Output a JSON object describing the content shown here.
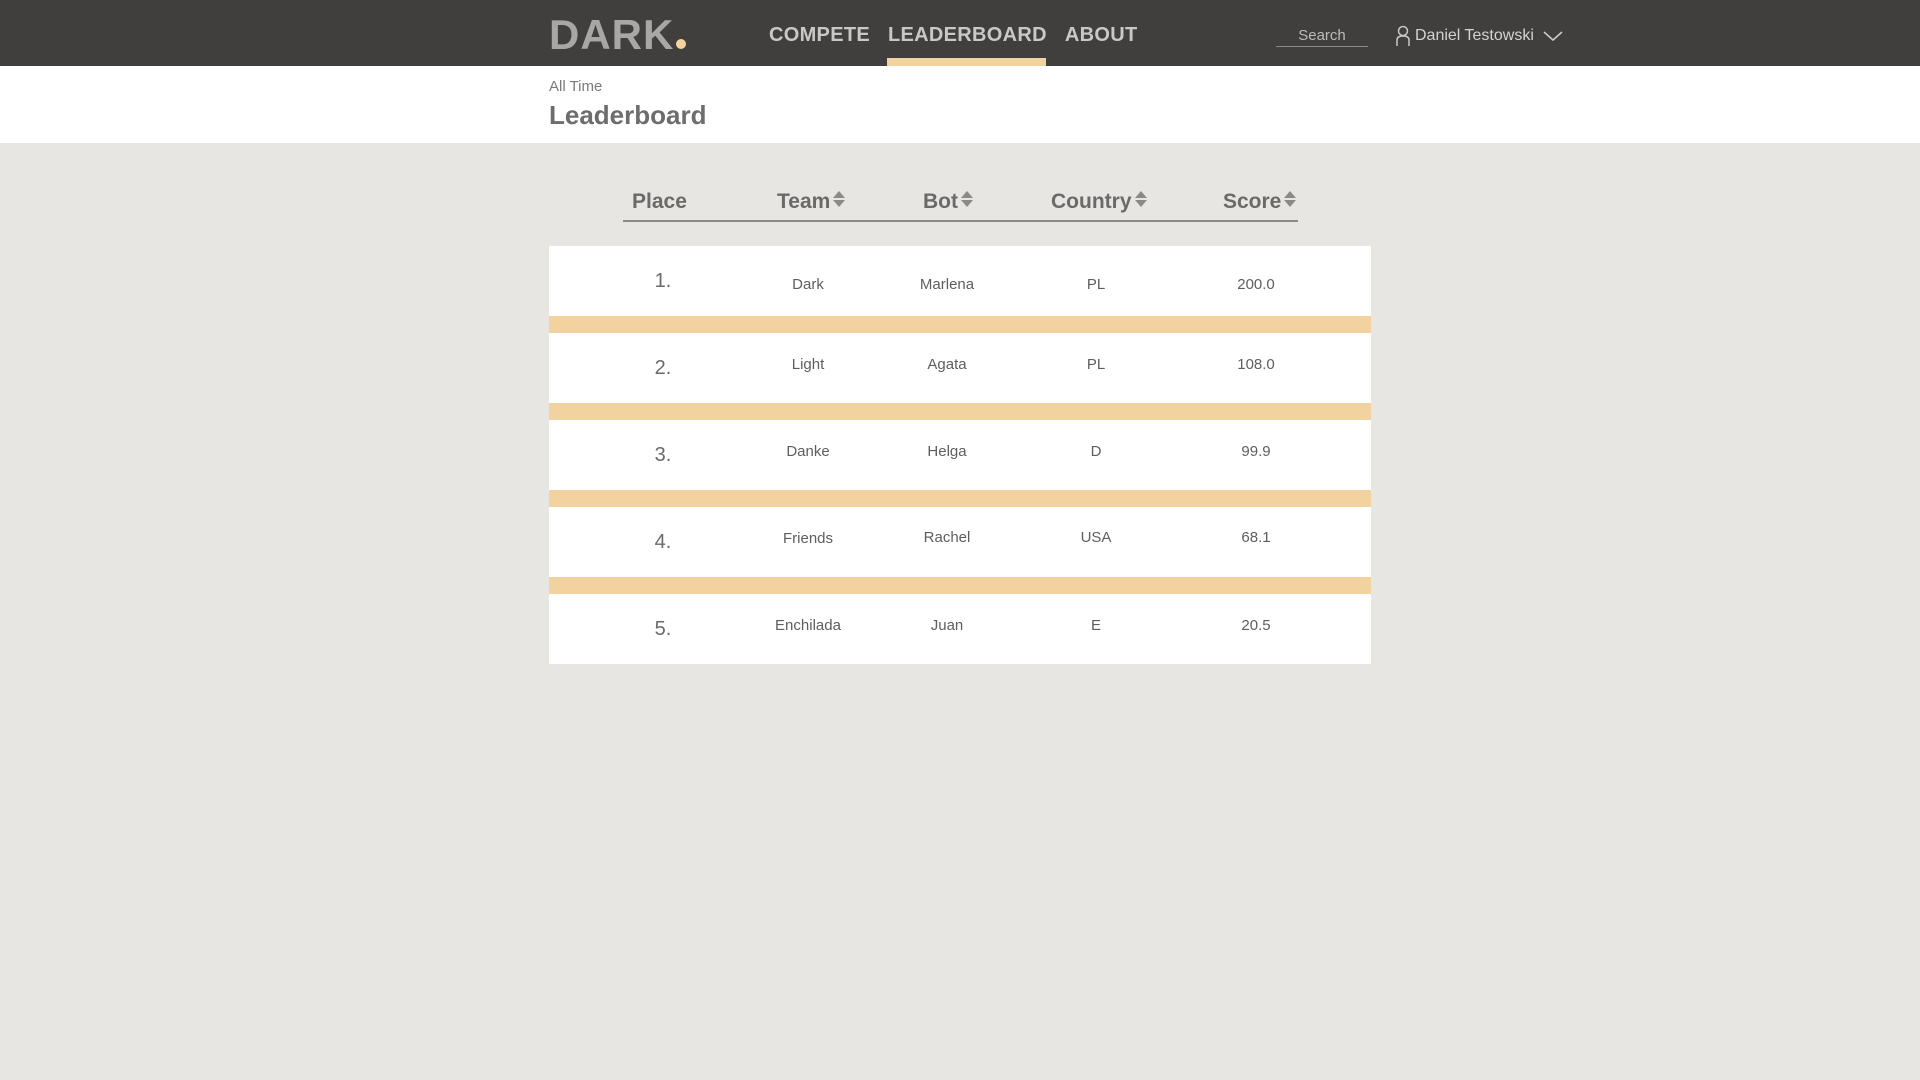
{
  "brand": {
    "name": "DARK",
    "accent": "#f2d3a0"
  },
  "nav": {
    "items": [
      {
        "label": "COMPETE",
        "active": false
      },
      {
        "label": "LEADERBOARD",
        "active": true
      },
      {
        "label": "ABOUT",
        "active": false
      }
    ]
  },
  "search": {
    "placeholder": "Search"
  },
  "user": {
    "name": "Daniel Testowski",
    "icon": "user-icon",
    "menu_icon": "chevron-down-icon"
  },
  "page": {
    "subtitle": "All Time",
    "title": "Leaderboard"
  },
  "table": {
    "columns": [
      {
        "label": "Place",
        "sortable": false
      },
      {
        "label": "Team",
        "sortable": true
      },
      {
        "label": "Bot",
        "sortable": true
      },
      {
        "label": "Country",
        "sortable": true
      },
      {
        "label": "Score",
        "sortable": true
      }
    ],
    "rows": [
      {
        "place": "1.",
        "team": "Dark",
        "bot": "Marlena",
        "country": "PL",
        "score": "200.0"
      },
      {
        "place": "2.",
        "team": "Light",
        "bot": "Agata",
        "country": "PL",
        "score": "108.0"
      },
      {
        "place": "3.",
        "team": "Danke",
        "bot": "Helga",
        "country": "D",
        "score": "99.9"
      },
      {
        "place": "4.",
        "team": "Friends",
        "bot": "Rachel",
        "country": "USA",
        "score": "68.1"
      },
      {
        "place": "5.",
        "team": "Enchilada",
        "bot": "Juan",
        "country": "E",
        "score": "20.5"
      }
    ],
    "separator_color": "#f2d3a0"
  }
}
